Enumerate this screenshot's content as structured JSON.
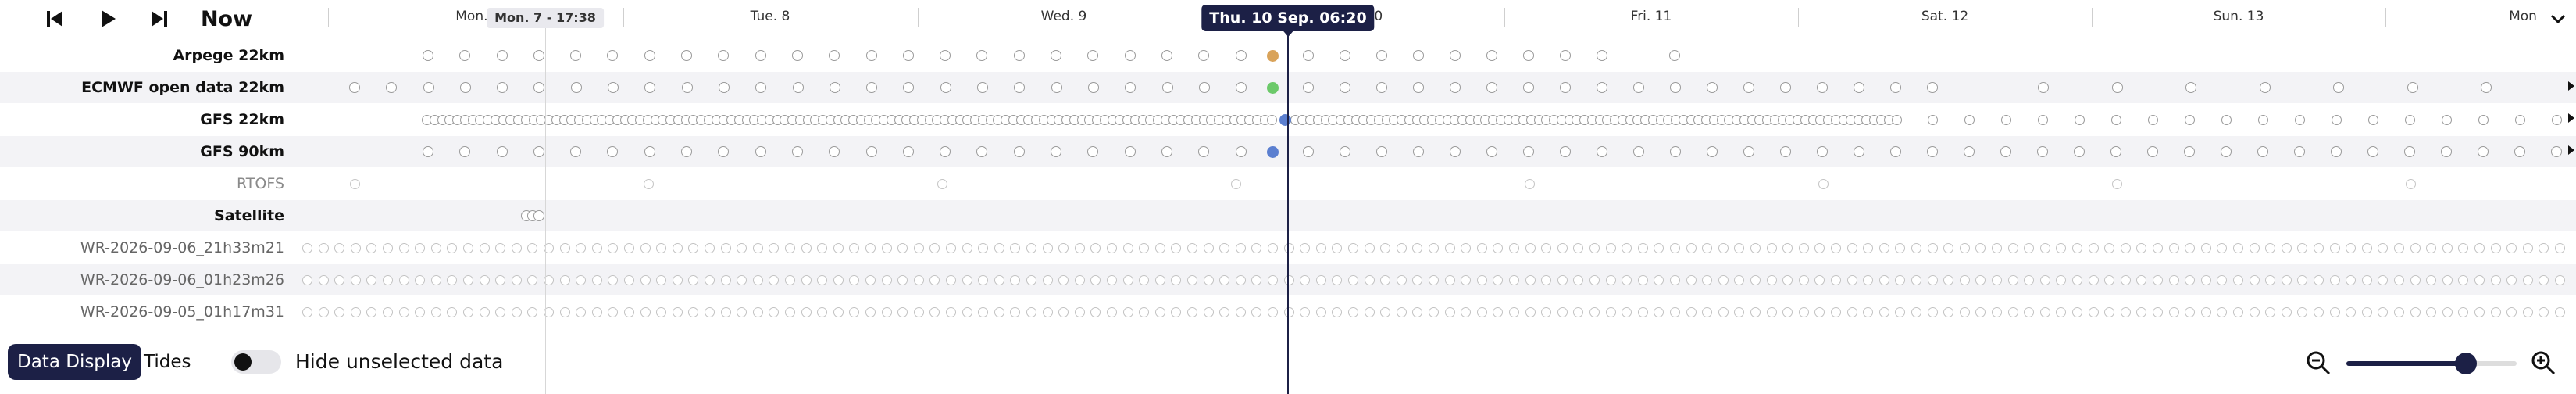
{
  "controls": {
    "skip_back_icon": "skip-back-icon",
    "play_icon": "play-icon",
    "skip_forward_icon": "skip-forward-icon",
    "now_label": "Now",
    "collapse_icon": "chevron-down-icon"
  },
  "timeline": {
    "day_labels": [
      "Mon. 7",
      "Tue. 8",
      "Wed. 9",
      "Thu. 10",
      "Fri. 11",
      "Sat. 12",
      "Sun. 13",
      "Mon"
    ],
    "past_marker_label": "Mon. 7 - 17:38",
    "current_time_label": "Thu. 10 Sep. 06:20"
  },
  "rows": [
    {
      "label": "Arpege 22km",
      "style": "bold"
    },
    {
      "label": "ECMWF open data 22km",
      "style": "bold"
    },
    {
      "label": "GFS 22km",
      "style": "bold"
    },
    {
      "label": "GFS 90km",
      "style": "bold"
    },
    {
      "label": "RTOFS",
      "style": "dim"
    },
    {
      "label": "Satellite",
      "style": "bold"
    },
    {
      "label": "WR-2026-09-06_21h33m21",
      "style": "dimmer"
    },
    {
      "label": "WR-2026-09-06_01h23m26",
      "style": "dimmer"
    },
    {
      "label": "WR-2026-09-05_01h17m31",
      "style": "dimmer"
    }
  ],
  "footer": {
    "tabs": [
      "Data Display",
      "Tides"
    ],
    "active_tab": "Data Display",
    "toggle_label": "Hide unselected data",
    "toggle_on": false,
    "zoom_out_icon": "zoom-out-icon",
    "zoom_in_icon": "zoom-in-icon",
    "zoom_level": 0.7
  },
  "colors": {
    "accent": "#1c2046",
    "arpege_selected": "#d9a35a",
    "ecmwf_selected": "#6cc96a",
    "gfs_selected": "#5b7fd0",
    "cursor": "#1c2046"
  }
}
